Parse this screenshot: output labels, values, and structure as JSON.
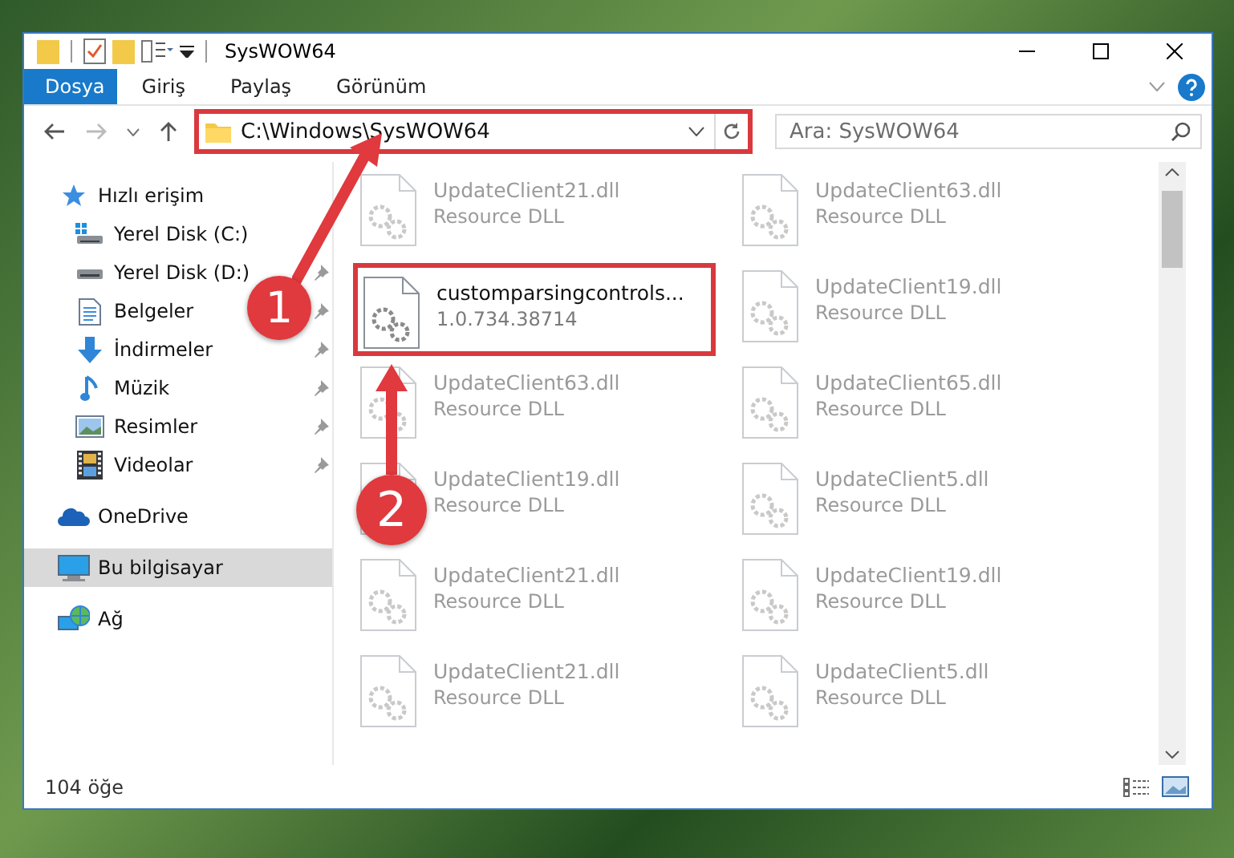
{
  "window": {
    "title": "SysWOW64"
  },
  "ribbon": {
    "tabs": [
      {
        "label": "Dosya",
        "selected": true
      },
      {
        "label": "Giriş",
        "selected": false
      },
      {
        "label": "Paylaş",
        "selected": false
      },
      {
        "label": "Görünüm",
        "selected": false
      }
    ]
  },
  "address_bar": {
    "path": "C:\\Windows\\SysWOW64",
    "highlighted": true
  },
  "search": {
    "placeholder": "Ara: SysWOW64"
  },
  "sidebar": {
    "items": [
      {
        "label": "Hızlı erişim",
        "kind": "star",
        "selected": false,
        "children": [
          {
            "label": "Yerel Disk (C:)",
            "kind": "drive-c",
            "pinned": false,
            "selected": false
          },
          {
            "label": "Yerel Disk (D:)",
            "kind": "drive",
            "pinned": true,
            "selected": false
          },
          {
            "label": "Belgeler",
            "kind": "documents",
            "pinned": true,
            "selected": false
          },
          {
            "label": "İndirmeler",
            "kind": "downloads",
            "pinned": true,
            "selected": false
          },
          {
            "label": "Müzik",
            "kind": "music",
            "pinned": true,
            "selected": false
          },
          {
            "label": "Resimler",
            "kind": "pictures",
            "pinned": true,
            "selected": false
          },
          {
            "label": "Videolar",
            "kind": "videos",
            "pinned": true,
            "selected": false
          }
        ]
      },
      {
        "label": "OneDrive",
        "kind": "cloud",
        "selected": false
      },
      {
        "label": "Bu bilgisayar",
        "kind": "computer",
        "selected": true
      },
      {
        "label": "Ağ",
        "kind": "network",
        "selected": false
      }
    ]
  },
  "files": [
    {
      "name": "UpdateClient21.dll",
      "detail": "Resource DLL",
      "dimmed": true,
      "highlighted": false
    },
    {
      "name": "UpdateClient63.dll",
      "detail": "Resource DLL",
      "dimmed": true,
      "highlighted": false
    },
    {
      "name": "customparsingcontrols...",
      "detail": "1.0.734.38714",
      "dimmed": false,
      "highlighted": true
    },
    {
      "name": "UpdateClient19.dll",
      "detail": "Resource DLL",
      "dimmed": true,
      "highlighted": false
    },
    {
      "name": "UpdateClient63.dll",
      "detail": "Resource DLL",
      "dimmed": true,
      "highlighted": false
    },
    {
      "name": "UpdateClient65.dll",
      "detail": "Resource DLL",
      "dimmed": true,
      "highlighted": false
    },
    {
      "name": "UpdateClient19.dll",
      "detail": "Resource DLL",
      "dimmed": true,
      "highlighted": false
    },
    {
      "name": "UpdateClient5.dll",
      "detail": "Resource DLL",
      "dimmed": true,
      "highlighted": false
    },
    {
      "name": "UpdateClient21.dll",
      "detail": "Resource DLL",
      "dimmed": true,
      "highlighted": false
    },
    {
      "name": "UpdateClient19.dll",
      "detail": "Resource DLL",
      "dimmed": true,
      "highlighted": false
    },
    {
      "name": "UpdateClient21.dll",
      "detail": "Resource DLL",
      "dimmed": true,
      "highlighted": false
    },
    {
      "name": "UpdateClient5.dll",
      "detail": "Resource DLL",
      "dimmed": true,
      "highlighted": false
    }
  ],
  "status_bar": {
    "item_count": "104 öğe"
  },
  "callouts": [
    {
      "label": "1"
    },
    {
      "label": "2"
    }
  ]
}
